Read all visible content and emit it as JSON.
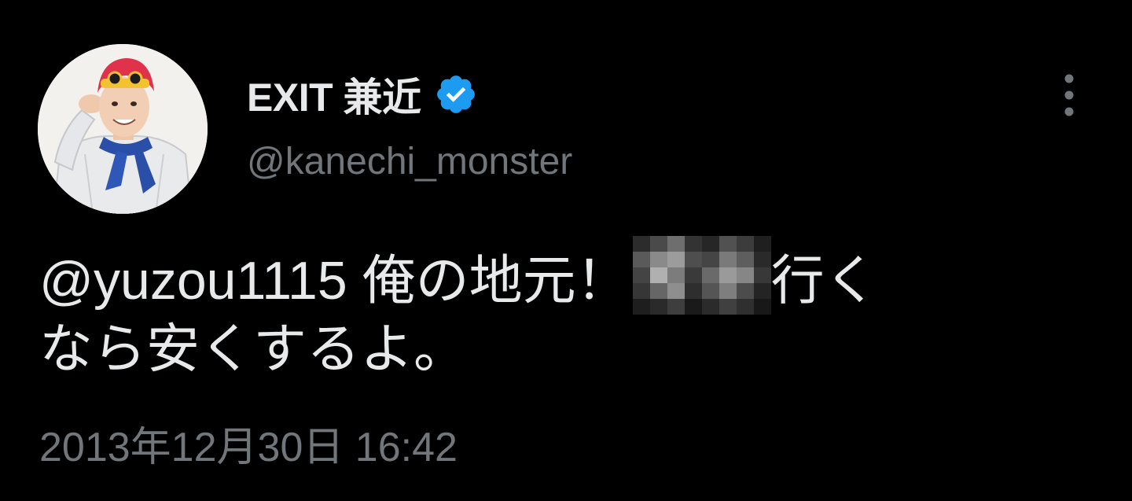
{
  "tweet": {
    "author": {
      "display_name": "EXIT 兼近",
      "handle": "@kanechi_monster",
      "verified_icon": "verified-badge-icon",
      "avatar_icon": "avatar"
    },
    "more_icon": "more-vertical-icon",
    "text": {
      "mention": "@yuzou1115",
      "line1_after_mention": "俺の地元！",
      "censored_icon": "pixelated-mosaic-censor",
      "line1_after_censor": "行く",
      "line2": "なら安くするよ。"
    },
    "timestamp": "2013年12月30日 16:42"
  },
  "colors": {
    "background": "#000000",
    "primary_text": "#e7e9ea",
    "secondary_text": "#71767b",
    "verified_blue": "#1d9bf0"
  }
}
